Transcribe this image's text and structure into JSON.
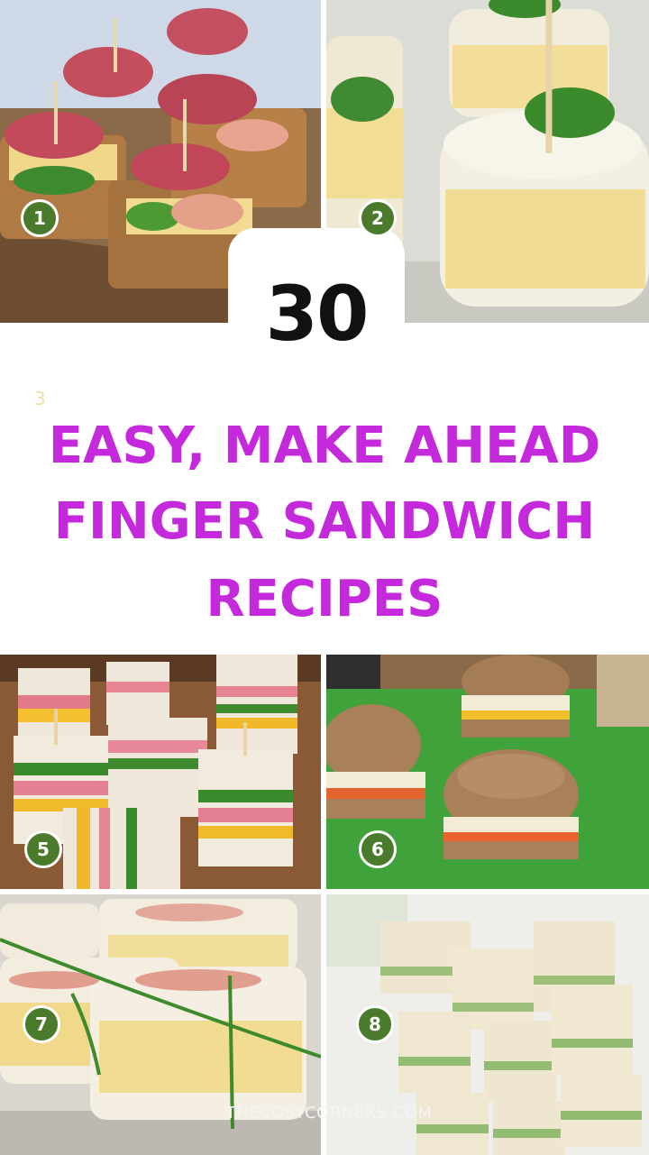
{
  "headline": {
    "count": "30",
    "lines": [
      "EASY, MAKE AHEAD",
      "FINGER SANDWICH",
      "RECIPES"
    ],
    "faint_number": "3",
    "color": "#c42adb"
  },
  "badges": {
    "b1": "1",
    "b2": "2",
    "b5": "5",
    "b6": "6",
    "b7": "7",
    "b8": "8",
    "color": "#4a7a2c"
  },
  "photos": [
    {
      "id": "1",
      "subject": "salami, ham, cheese and cucumber toothpick bites on wood board"
    },
    {
      "id": "2",
      "subject": "round egg salad sandwiches topped with parsley"
    },
    {
      "id": "5",
      "subject": "layered ham, cheese and lettuce club sandwich squares"
    },
    {
      "id": "6",
      "subject": "shaped wheat bread sandwiches on green board"
    },
    {
      "id": "7",
      "subject": "egg salad sandwiches tied with chives"
    },
    {
      "id": "8",
      "subject": "stacked cucumber tea sandwiches"
    }
  ],
  "watermark": "THECOSYCORNERS.COM"
}
